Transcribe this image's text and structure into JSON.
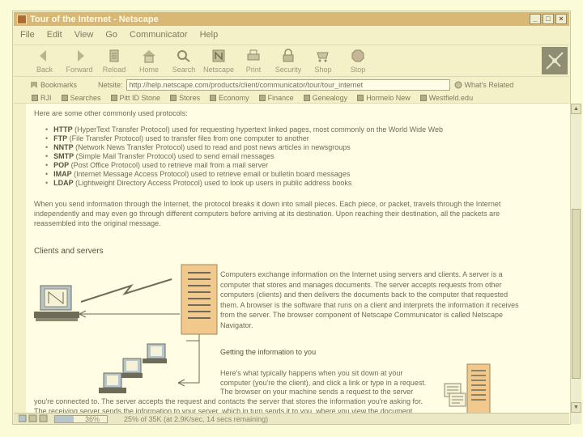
{
  "window": {
    "title": "Tour of the Internet - Netscape",
    "controls": [
      "_",
      "□",
      "×"
    ]
  },
  "menu": [
    "File",
    "Edit",
    "View",
    "Go",
    "Communicator",
    "Help"
  ],
  "toolbar": {
    "buttons": [
      {
        "label": "Back",
        "icon": "back-arrow-icon"
      },
      {
        "label": "Forward",
        "icon": "forward-arrow-icon"
      },
      {
        "label": "Reload",
        "icon": "reload-icon"
      },
      {
        "label": "Home",
        "icon": "home-icon"
      },
      {
        "label": "Search",
        "icon": "search-icon"
      },
      {
        "label": "Netscape",
        "icon": "netscape-icon"
      },
      {
        "label": "Print",
        "icon": "print-icon"
      },
      {
        "label": "Security",
        "icon": "lock-icon"
      },
      {
        "label": "Shop",
        "icon": "shop-icon"
      },
      {
        "label": "Stop",
        "icon": "stop-icon"
      }
    ]
  },
  "location": {
    "bookmarks_label": "Bookmarks",
    "netsite_label": "Netsite:",
    "url": "http://help.netscape.com/products/client/communicator/tour/tour_internet",
    "related_label": "What's Related"
  },
  "personal_toolbar": [
    "RJI",
    "Searches",
    "Pitt ID Stone",
    "Stores",
    "Economy",
    "Finance",
    "Genealogy",
    "Hormelo New",
    "Westfield.edu"
  ],
  "content": {
    "intro": "Here are some other commonly used protocols:",
    "protocols": [
      {
        "name": "HTTP",
        "desc": " (HyperText Transfer Protocol) used for requesting hypertext linked pages, most commonly on the World Wide Web"
      },
      {
        "name": "FTP",
        "desc": " (File Transfer Protocol) used to transfer files from one computer to another"
      },
      {
        "name": "NNTP",
        "desc": " (Network News Transfer Protocol) used to read and post news articles in newsgroups"
      },
      {
        "name": "SMTP",
        "desc": " (Simple Mail Transfer Protocol) used to send email messages"
      },
      {
        "name": "POP",
        "desc": " (Post Office Protocol) used to retrieve mail from a mail server"
      },
      {
        "name": "IMAP",
        "desc": " (Internet Message Access Protocol) used to retrieve email or bulletin board messages"
      },
      {
        "name": "LDAP",
        "desc": " (Lightweight Directory Access Protocol) used to look up users in public address books"
      }
    ],
    "para_lines": [
      "When you send information through the Internet, the protocol breaks it down into small pieces. Each piece, or packet, travels through the Internet",
      "independently and may even go through different computers before arriving at its destination. Upon reaching their destination, all the packets are",
      "reassembled into the original message."
    ],
    "clients_heading": "Clients and servers",
    "clients_lines": [
      "Computers exchange information on the Internet using servers and clients. A server is a",
      "computer that stores and manages documents. The server accepts requests from other",
      "computers (clients) and then delivers the documents back to the computer that requested",
      "them. A browser is the software that runs on a client and interprets the information it receives",
      "from the server. The browser component of Netscape Communicator is called Netscape",
      "Navigator."
    ],
    "getting_heading": "Getting the information to you",
    "getting_lines": [
      "Here's what typically happens when you sit down at your",
      "computer (you're the client), and click a link or type in a request.",
      "The browser on your machine sends a request to the server",
      "you're connected to. The server accepts the request and contacts the server that stores the information you're asking for.",
      "The receiving server sends the information to your server, which in turn sends it to you, where you view the document."
    ]
  },
  "status": {
    "progress_percent": 36,
    "percent_text": "36%",
    "message": "25% of 35K (at 2.9K/sec, 14 secs remaining)"
  }
}
